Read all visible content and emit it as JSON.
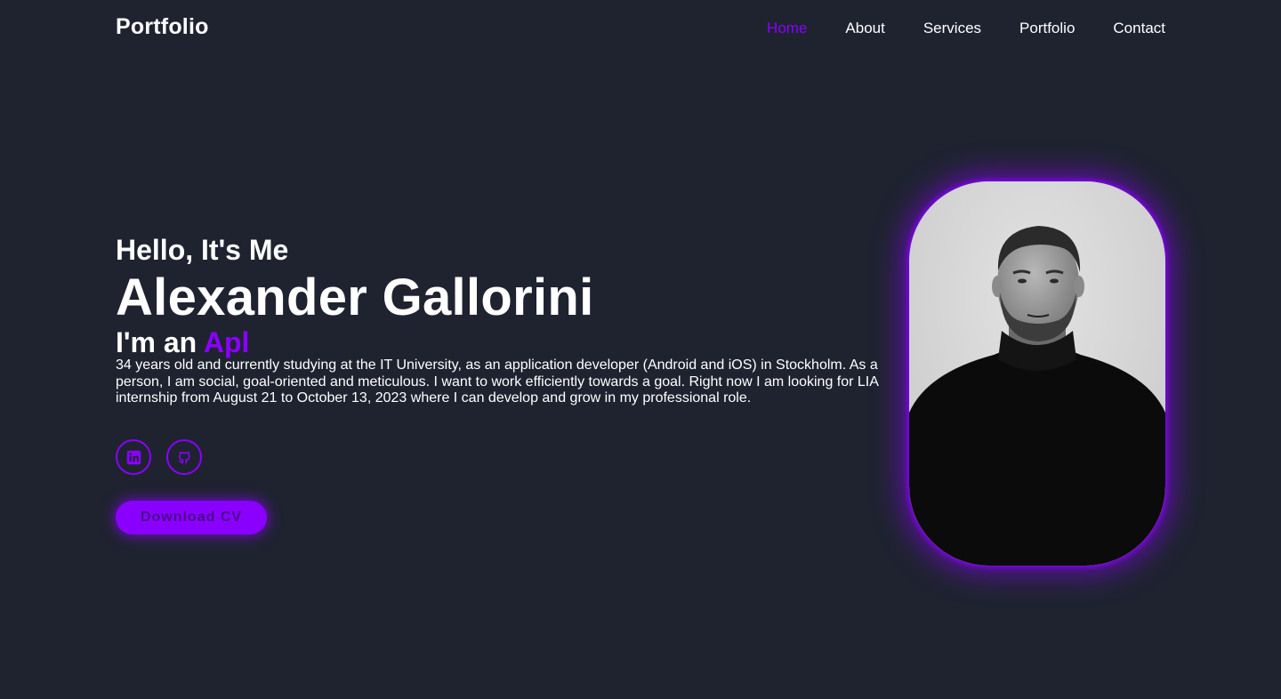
{
  "header": {
    "logo": "Portfolio",
    "nav": [
      {
        "label": "Home",
        "active": true
      },
      {
        "label": "About",
        "active": false
      },
      {
        "label": "Services",
        "active": false
      },
      {
        "label": "Portfolio",
        "active": false
      },
      {
        "label": "Contact",
        "active": false
      }
    ]
  },
  "hero": {
    "greeting": "Hello, It's Me",
    "name": "Alexander Gallorini",
    "role_prefix": "I'm an",
    "role_typed": "Apl",
    "bio": "34 years old and currently studying at the IT University, as an application developer (Android and iOS) in Stockholm. As a person, I am social, goal-oriented and meticulous. I want to work efficiently towards a goal. Right now I am looking for LIA internship from August 21 to October 13, 2023 where I can develop and grow in my professional role.",
    "socials": [
      {
        "icon": "linkedin-icon"
      },
      {
        "icon": "github-icon"
      }
    ],
    "cv_button": "Download CV"
  },
  "colors": {
    "background": "#1f2330",
    "accent": "#8a00ff",
    "text": "#ffffff"
  }
}
